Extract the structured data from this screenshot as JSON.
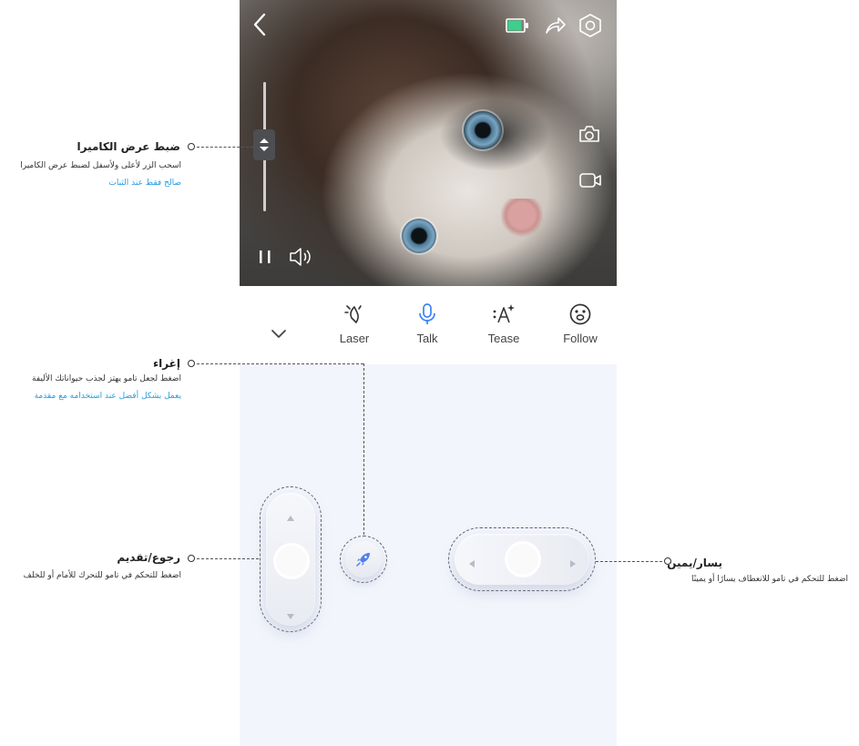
{
  "toolbar": {
    "items": [
      {
        "label": "Laser",
        "icon": "laser-icon"
      },
      {
        "label": "Talk",
        "icon": "microphone-icon"
      },
      {
        "label": "Tease",
        "icon": "sparkle-text-icon"
      },
      {
        "label": "Follow",
        "icon": "paw-face-icon"
      }
    ],
    "collapse_icon": "chevron-down-icon"
  },
  "video": {
    "top_icons": [
      "back-chevron-icon",
      "battery-icon",
      "share-icon",
      "settings-hexagon-icon"
    ],
    "side_icons": [
      "camera-icon",
      "video-record-icon"
    ],
    "bottom_icons": [
      "pause-icon",
      "speaker-icon"
    ]
  },
  "callouts": {
    "camera": {
      "title": "ضبط عرض الكاميرا",
      "text": "اسحب الزر لأعلى ولأسفل لضبط عرض الكاميرا",
      "note": "صالح فقط عند الثبات"
    },
    "tease": {
      "title": "إغراء",
      "text": "اضغط لجعل تامو يهتز لجذب حيواناتك الأليفة",
      "note": "يعمل بشكل أفضل عند استخدامه مع مقدمة"
    },
    "forward": {
      "title": "رجوع/تقديم",
      "text": "اضغط للتحكم في تامو للتحرك للأمام أو للخلف"
    },
    "turn": {
      "title": "يسار/يمين",
      "text": "اضغط للتحكم في تامو للانعطاف يسارًا أو يمينًا"
    }
  },
  "colors": {
    "accent_blue": "#2a9be0",
    "battery_green": "#3ccf8e",
    "talk_blue": "#3b82f6"
  }
}
